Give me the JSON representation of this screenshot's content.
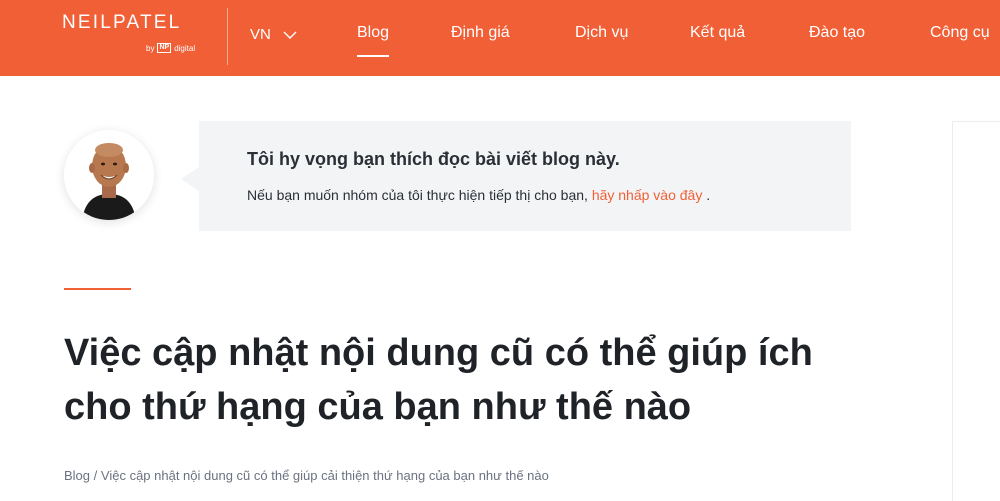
{
  "brand": {
    "name": "NEILPATEL",
    "by_label": "by",
    "np_badge": "NP",
    "np_suffix": "digital",
    "primary_color": "#f05f36"
  },
  "header": {
    "language": "VN",
    "nav": [
      {
        "label": "Blog",
        "active": true
      },
      {
        "label": "Định giá",
        "active": false
      },
      {
        "label": "Dịch vụ",
        "active": false
      },
      {
        "label": "Kết quả",
        "active": false
      },
      {
        "label": "Đào tạo",
        "active": false
      },
      {
        "label": "Công cụ",
        "active": false
      }
    ]
  },
  "author_box": {
    "title": "Tôi hy vọng bạn thích đọc bài viết blog này.",
    "subtitle_prefix": "Nếu bạn muốn nhóm của tôi thực hiện tiếp thị cho bạn,",
    "link_text": "hãy nhấp vào đây",
    "subtitle_suffix": "."
  },
  "article": {
    "headline": "Việc cập nhật nội dung cũ có thể giúp ích cho thứ hạng của bạn như thế nào",
    "breadcrumb": {
      "root": "Blog",
      "separator": "/",
      "current": "Việc cập nhật nội dung cũ có thể giúp cải thiện thứ hạng của bạn như thế nào"
    }
  }
}
